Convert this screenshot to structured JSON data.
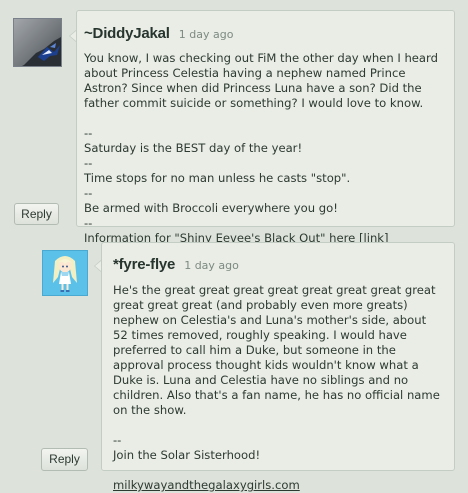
{
  "comments": [
    {
      "username": "~DiddyJakal",
      "timestamp": "1 day ago",
      "avatar_icon": "shadow-dragon-avatar",
      "body_main": "You know, I was checking out FiM the other day when I heard\nabout Princess Celestia having a nephew named Prince\nAstron? Since when did Princess Luna have a son? Did the\nfather commit suicide or something? I would love to know.",
      "signature": "--\nSaturday is the BEST day of the year!\n--\nTime stops for no man unless he casts \"stop\".\n--\nBe armed with Broccoli everywhere you go!\n--\nInformation for \"Shiny Eevee's Black Out\" here ",
      "signature_link": "[link]",
      "reply_label": "Reply"
    },
    {
      "username": "*fyre-flye",
      "timestamp": "1 day ago",
      "avatar_icon": "blonde-pony-girl-avatar",
      "body_main": "He's the great great great great great great great great\ngreat great great (and probably even more greats)\nnephew on Celestia's and Luna's mother's side, about\n52 times removed, roughly speaking. I would have\npreferred to call him a Duke, but someone in the\napproval process thought kids wouldn't know what a\nDuke is. Luna and Celestia have no siblings and no\nchildren. Also that's a fan name, he has no official name\non the show.",
      "signature": "--\nJoin the Solar Sisterhood!\n\n",
      "signature_link": "milkywayandthegalaxygirls.com",
      "reply_label": "Reply"
    }
  ],
  "colors": {
    "page_background": "#dde3da",
    "bubble_background": "#e9ede6",
    "bubble_border": "#c4cdc3",
    "text": "#2d3a32",
    "timestamp": "#7d8a82",
    "avatar2_background": "#5cc1e9"
  }
}
